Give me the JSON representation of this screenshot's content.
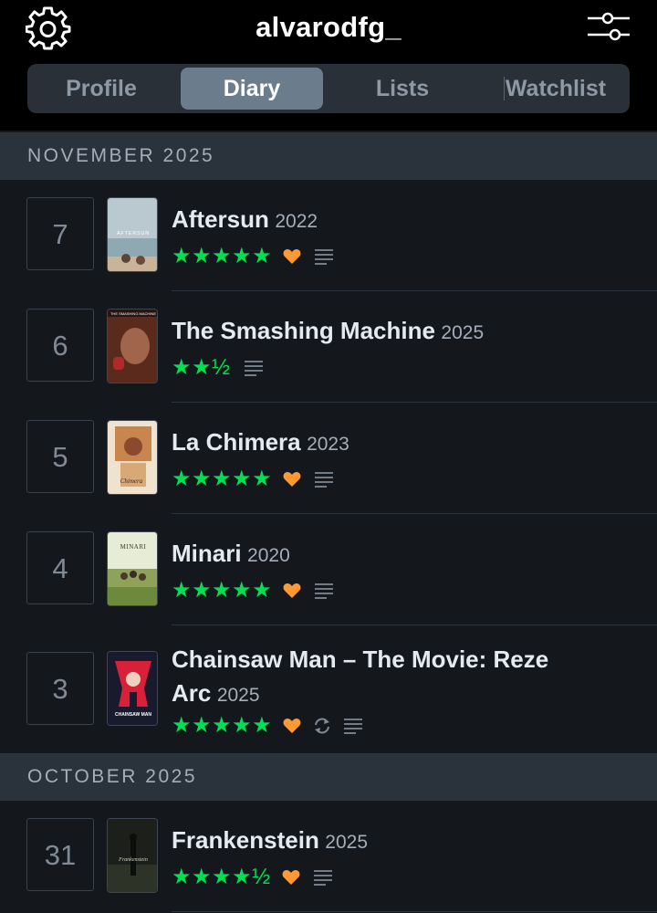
{
  "header": {
    "username": "alvarodfg_",
    "settings_icon": "gear-icon",
    "filter_icon": "sliders-icon"
  },
  "tabs": [
    {
      "label": "Profile"
    },
    {
      "label": "Diary",
      "active": true
    },
    {
      "label": "Lists"
    },
    {
      "label": "Watchlist"
    }
  ],
  "colors": {
    "star": "#00e054",
    "heart": "#ff9933",
    "background": "#14181c",
    "section": "#2a323c"
  },
  "sections": [
    {
      "month": "NOVEMBER 2025",
      "entries": [
        {
          "day": "7",
          "title": "Aftersun",
          "year": "2022",
          "rating": "★★★★★",
          "liked": true,
          "rewatch": false,
          "review": true,
          "poster_text": "AFTERSUN"
        },
        {
          "day": "6",
          "title": "The Smashing Machine",
          "year": "2025",
          "rating": "★★½",
          "liked": false,
          "rewatch": false,
          "review": true,
          "poster_text": "THE SMASHING MACHINE"
        },
        {
          "day": "5",
          "title": "La Chimera",
          "year": "2023",
          "rating": "★★★★★",
          "liked": true,
          "rewatch": false,
          "review": true,
          "poster_text": "Chimera"
        },
        {
          "day": "4",
          "title": "Minari",
          "year": "2020",
          "rating": "★★★★★",
          "liked": true,
          "rewatch": false,
          "review": true,
          "poster_text": "MINARI"
        },
        {
          "day": "3",
          "title": "Chainsaw Man – The Movie: Reze",
          "title_cont": "Arc",
          "year": "2025",
          "rating": "★★★★★",
          "liked": true,
          "rewatch": true,
          "review": true,
          "poster_text": "CHAINSAW MAN"
        }
      ]
    },
    {
      "month": "OCTOBER 2025",
      "entries": [
        {
          "day": "31",
          "title": "Frankenstein",
          "year": "2025",
          "rating": "★★★★½",
          "liked": true,
          "rewatch": false,
          "review": true,
          "poster_text": "Frankenstein"
        }
      ]
    }
  ]
}
